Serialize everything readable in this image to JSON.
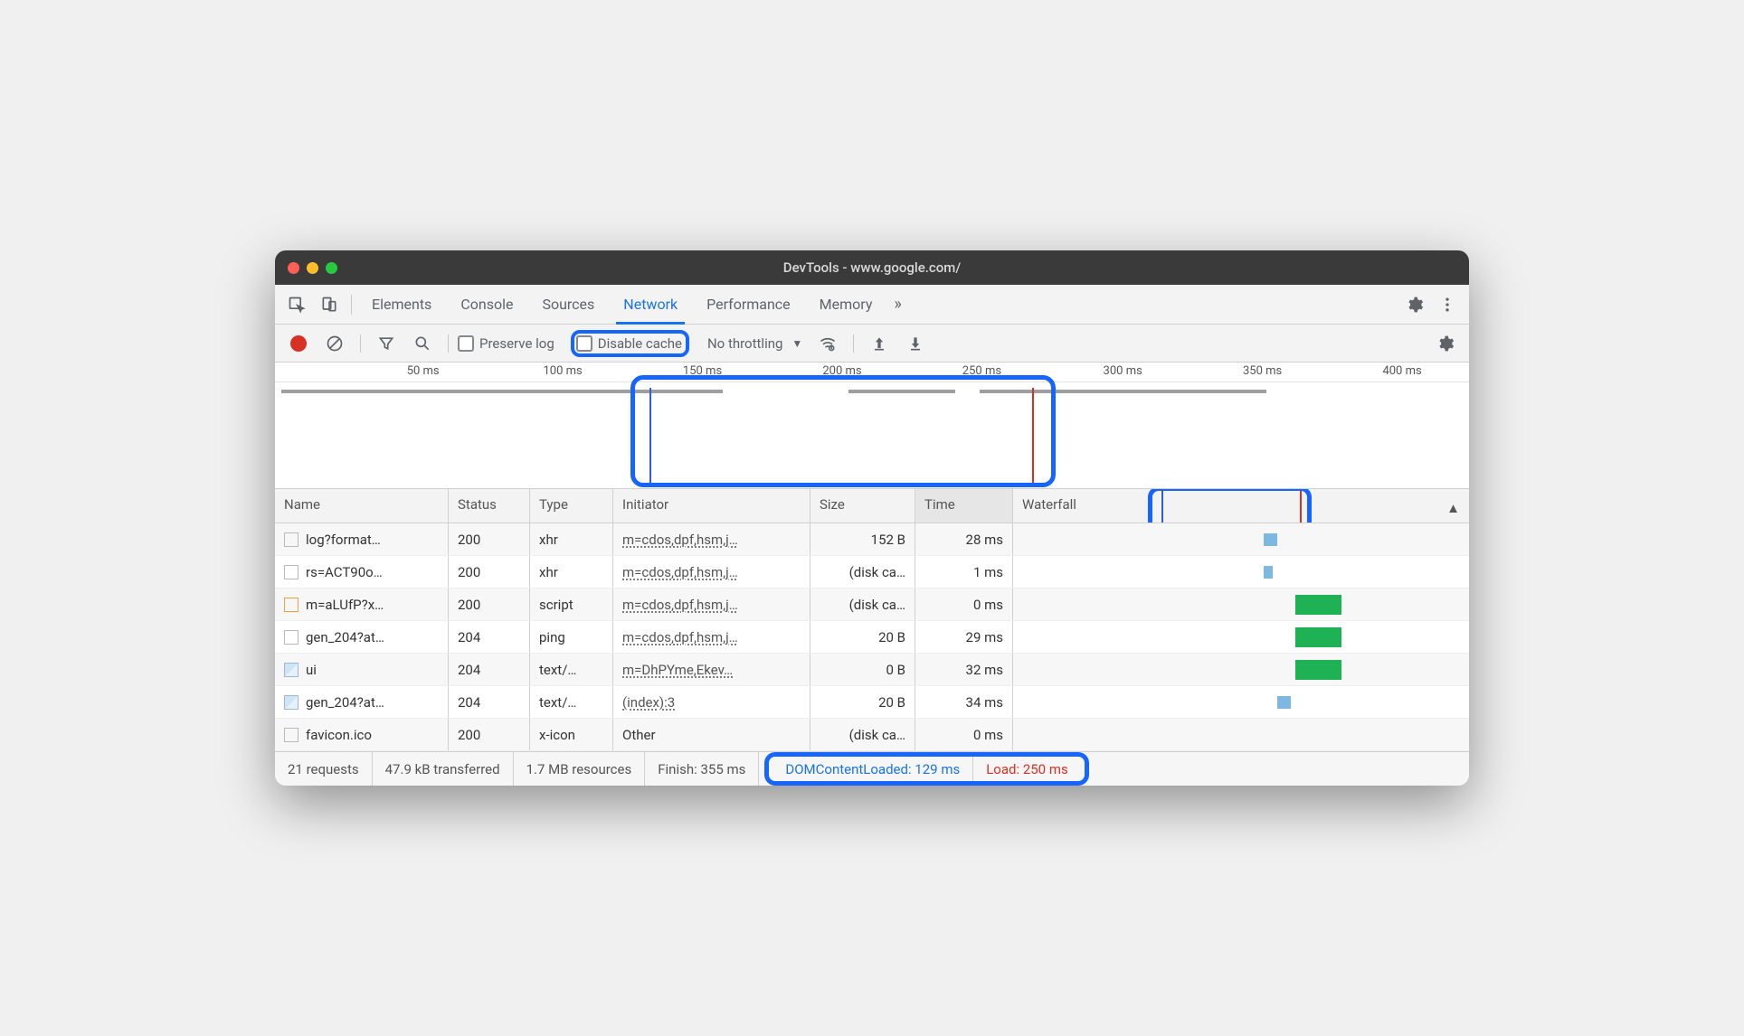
{
  "window": {
    "title": "DevTools - www.google.com/"
  },
  "tabs": {
    "items": [
      "Elements",
      "Console",
      "Sources",
      "Network",
      "Performance",
      "Memory"
    ],
    "active": "Network",
    "more": "»"
  },
  "toolbar": {
    "preserve_log": "Preserve log",
    "disable_cache": "Disable cache",
    "throttling": "No throttling"
  },
  "overview": {
    "ticks": [
      "50 ms",
      "100 ms",
      "150 ms",
      "200 ms",
      "250 ms",
      "300 ms",
      "350 ms",
      "400 ms"
    ]
  },
  "columns": {
    "name": "Name",
    "status": "Status",
    "type": "Type",
    "initiator": "Initiator",
    "size": "Size",
    "time": "Time",
    "waterfall": "Waterfall"
  },
  "rows": [
    {
      "name": "log?format…",
      "status": "200",
      "type": "xhr",
      "initiator": "m=cdos,dpf,hsm,j…",
      "size": "152 B",
      "time": "28 ms",
      "icon": "doc"
    },
    {
      "name": "rs=ACT90o…",
      "status": "200",
      "type": "xhr",
      "initiator": "m=cdos,dpf,hsm,j…",
      "size": "(disk ca…",
      "time": "1 ms",
      "icon": "doc"
    },
    {
      "name": "m=aLUfP?x…",
      "status": "200",
      "type": "script",
      "initiator": "m=cdos,dpf,hsm,j…",
      "size": "(disk ca…",
      "time": "0 ms",
      "icon": "script"
    },
    {
      "name": "gen_204?at…",
      "status": "204",
      "type": "ping",
      "initiator": "m=cdos,dpf,hsm,j…",
      "size": "20 B",
      "time": "29 ms",
      "icon": "doc"
    },
    {
      "name": "ui",
      "status": "204",
      "type": "text/…",
      "initiator": "m=DhPYme,Ekev…",
      "size": "0 B",
      "time": "32 ms",
      "icon": "img"
    },
    {
      "name": "gen_204?at…",
      "status": "204",
      "type": "text/…",
      "initiator": "(index):3",
      "size": "20 B",
      "time": "34 ms",
      "icon": "img"
    },
    {
      "name": "favicon.ico",
      "status": "200",
      "type": "x-icon",
      "initiator": "Other",
      "size": "(disk ca…",
      "time": "0 ms",
      "icon": "doc",
      "plain": true
    }
  ],
  "status": {
    "requests": "21 requests",
    "transferred": "47.9 kB transferred",
    "resources": "1.7 MB resources",
    "finish": "Finish: 355 ms",
    "dcl": "DOMContentLoaded: 129 ms",
    "load": "Load: 250 ms"
  }
}
